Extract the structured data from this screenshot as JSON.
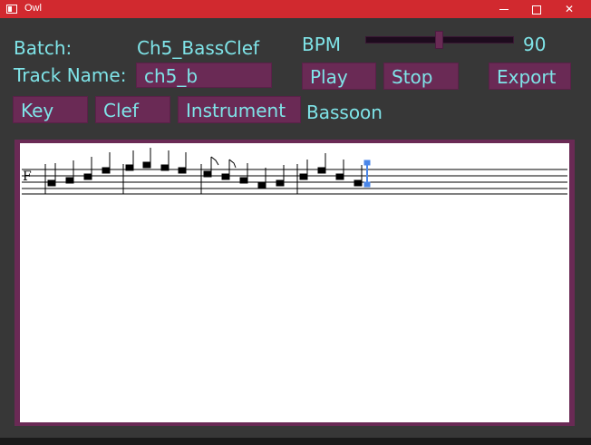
{
  "window": {
    "title": "Owl"
  },
  "batch": {
    "label": "Batch:",
    "value": "Ch5_BassClef"
  },
  "track": {
    "label": "Track Name:",
    "value": "ch5_b"
  },
  "bpm": {
    "label": "BPM",
    "value": "90",
    "slider_fraction": 0.49
  },
  "buttons": {
    "play": "Play",
    "stop": "Stop",
    "export": "Export",
    "key": "Key",
    "clef": "Clef",
    "instrument": "Instrument"
  },
  "instrument_value": "Bassoon",
  "score": {
    "clef_symbol": "F",
    "colors": {
      "note": "#000000",
      "cursor": "#4a86e8",
      "accent": "#6a2a55",
      "text": "#7fe4e8"
    }
  }
}
